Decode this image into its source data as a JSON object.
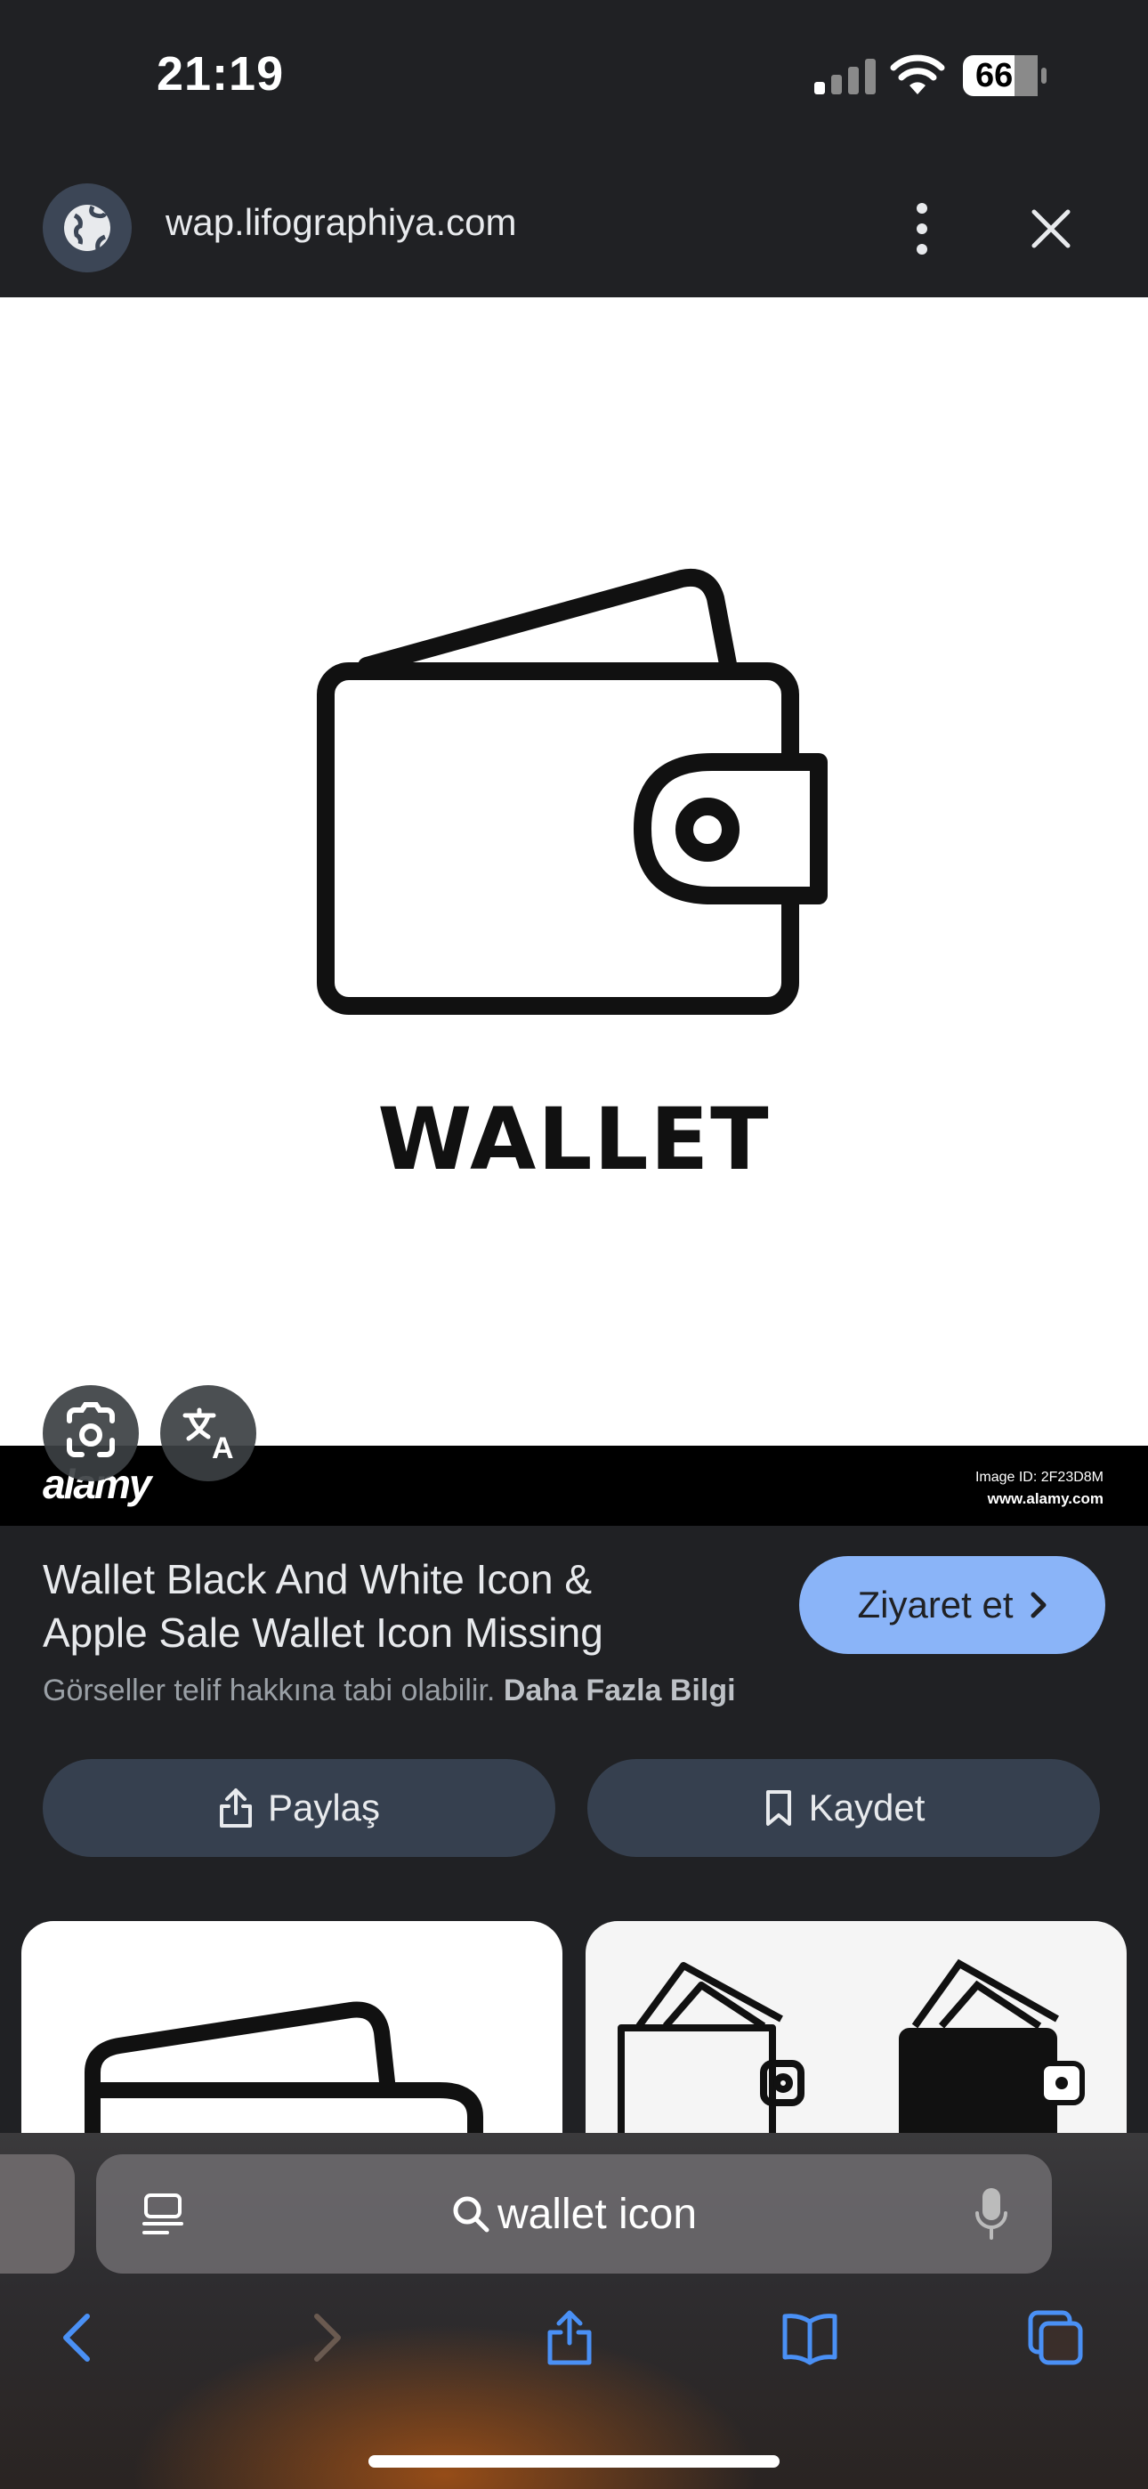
{
  "status_bar": {
    "time": "21:19",
    "battery": "66"
  },
  "url_bar": {
    "url": "wap.lifographiya.com"
  },
  "image": {
    "caption_word": "WALLET",
    "watermark_logo": "alamy",
    "image_id": "Image ID: 2F23D8M",
    "watermark_site": "www.alamy.com"
  },
  "info": {
    "title_line1": "Wallet Black And White Icon &",
    "title_line2": "Apple Sale Wallet Icon Missing",
    "visit_label": "Ziyaret et",
    "copyright_text": "Görseller telif hakkına tabi olabilir.",
    "learn_more": "Daha Fazla Bilgi",
    "share_label": "Paylaş",
    "save_label": "Kaydet"
  },
  "safari": {
    "search_query": "wallet icon"
  },
  "icons": {
    "site": "globe-icon",
    "menu": "more-vert-icon",
    "close": "close-icon",
    "lens": "lens-icon",
    "translate": "translate-icon",
    "share": "share-icon",
    "bookmark": "bookmark-icon",
    "reader": "reader-icon",
    "search": "search-icon",
    "mic": "microphone-icon",
    "back": "back-icon",
    "forward": "forward-icon",
    "safari_share": "share-icon",
    "bookmarks": "book-icon",
    "tabs": "tabs-icon"
  },
  "colors": {
    "accent": "#8ab4f8",
    "background": "#202124",
    "button": "#36404f"
  }
}
